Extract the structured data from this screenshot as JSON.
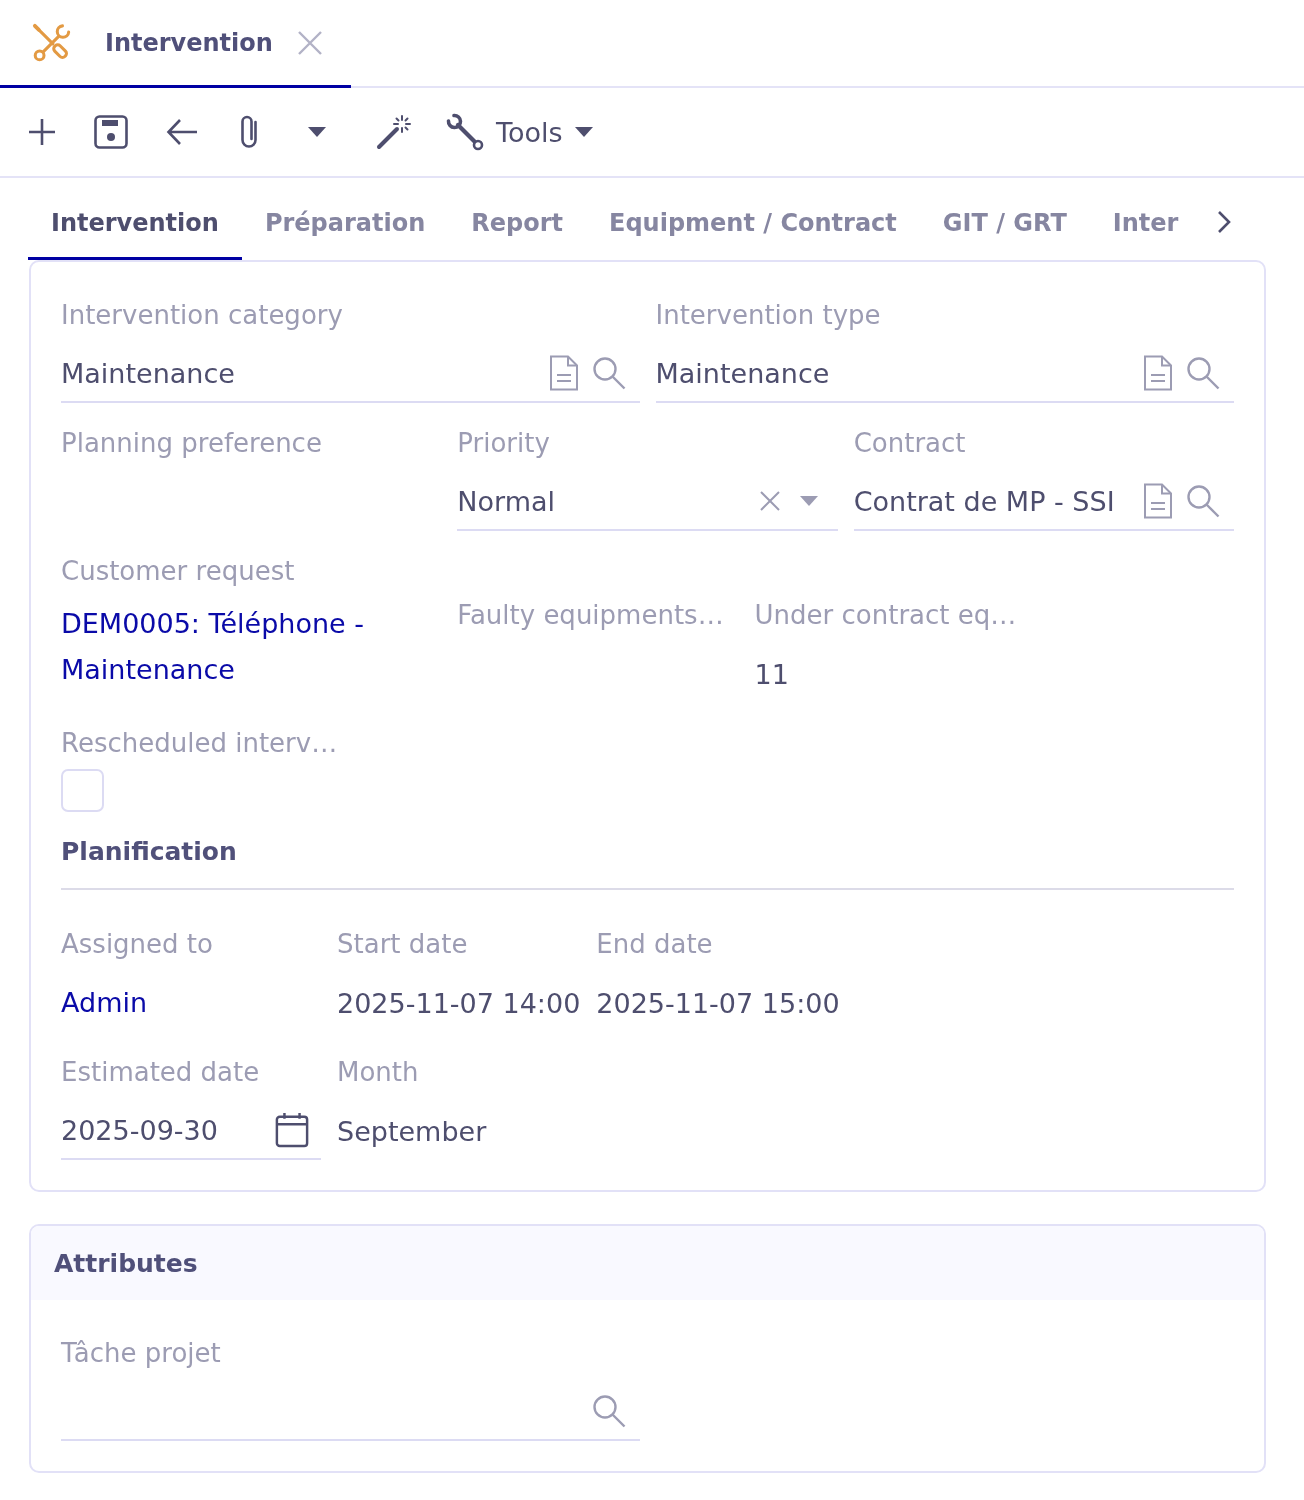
{
  "window_tabs": [
    {
      "title": "Intervention",
      "selected": true
    }
  ],
  "toolbar": {
    "tools_label": "Tools"
  },
  "tabs": [
    {
      "label": "Intervention",
      "selected": true
    },
    {
      "label": "Préparation",
      "selected": false
    },
    {
      "label": "Report",
      "selected": false
    },
    {
      "label": "Equipment / Contract",
      "selected": false
    },
    {
      "label": "GIT / GRT",
      "selected": false
    },
    {
      "label": "Inter",
      "selected": false
    }
  ],
  "main_panel": {
    "rows": [
      [
        {
          "kind": "lookup",
          "label": "Intervention category",
          "value": "Maintenance"
        },
        {
          "kind": "lookup",
          "label": "Intervention type",
          "value": "Maintenance"
        }
      ],
      [
        {
          "kind": "text",
          "label": "Planning preference"
        },
        {
          "kind": "select",
          "label": "Priority",
          "value": "Normal"
        },
        {
          "kind": "lookup",
          "label": "Contract",
          "value": "Contrat de MP - SSI"
        }
      ],
      [
        {
          "kind": "link",
          "label": "Customer request",
          "value": "DEM0005: Téléphone - Maintenance"
        },
        {
          "kind": "text",
          "label": "Faulty equipments…"
        },
        {
          "kind": "text",
          "label": "Under contract eq…",
          "value": "11"
        }
      ],
      [
        {
          "kind": "checkbox",
          "label": "Rescheduled interv…",
          "checked": false
        }
      ]
    ],
    "planification": {
      "title": "Planification",
      "rows": [
        [
          {
            "kind": "link",
            "label": "Assigned to",
            "value": "Admin"
          },
          {
            "kind": "text",
            "label": "Start date",
            "value": "2025-11-07 14:00"
          },
          {
            "kind": "text",
            "label": "End date",
            "value": "2025-11-07 15:00"
          }
        ],
        [
          {
            "kind": "date",
            "label": "Estimated date",
            "value": "2025-09-30"
          },
          {
            "kind": "text",
            "label": "Month",
            "value": "September"
          }
        ]
      ]
    }
  },
  "attributes_panel": {
    "title": "Attributes",
    "fields": [
      {
        "kind": "search",
        "label": "Tâche projet"
      }
    ]
  }
}
